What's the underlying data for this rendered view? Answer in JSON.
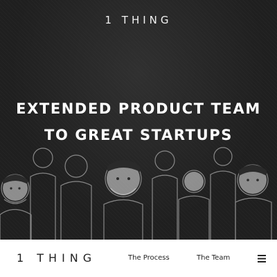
{
  "hero": {
    "logo": "1 THING",
    "headline_line1": "EXTENDED PRODUCT TEAM",
    "headline_line2": "TO GREAT STARTUPS",
    "background_color": "#1f1f1f",
    "illustration_icon": "team-people-sketch"
  },
  "navbar": {
    "logo": "1 THING",
    "links": [
      "The Process",
      "The Team"
    ],
    "menu_icon": "hamburger-menu-icon",
    "background_color": "#ffffff"
  }
}
